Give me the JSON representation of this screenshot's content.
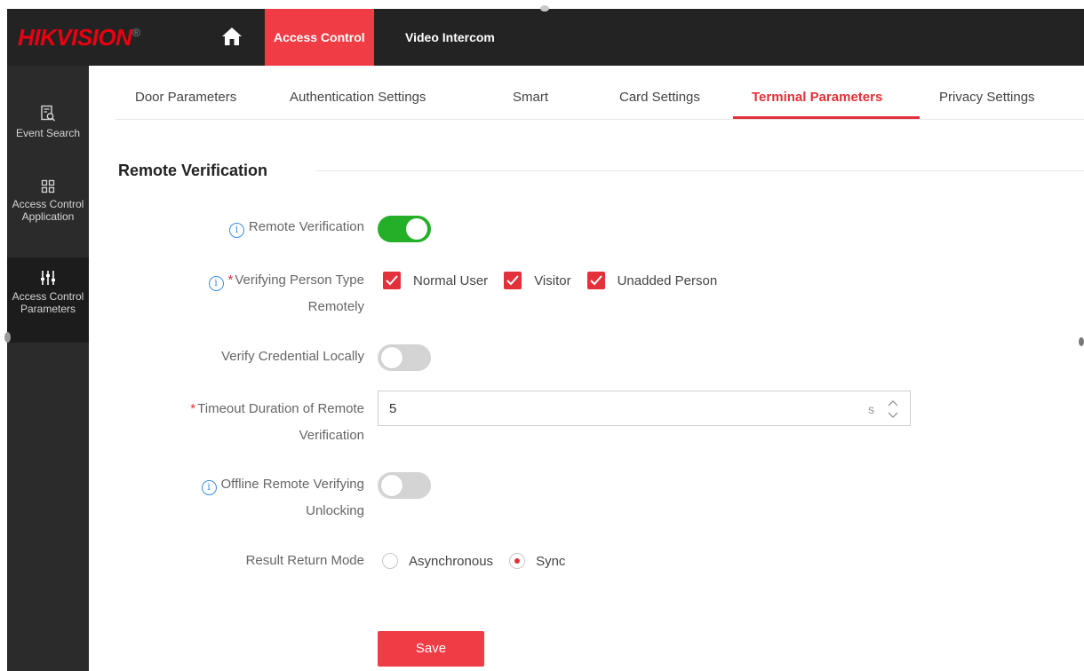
{
  "header": {
    "logo_main": "HIKVISION",
    "logo_mark": "®",
    "nav": [
      "Access Control",
      "Video Intercom"
    ],
    "home_icon": "home-icon"
  },
  "sidebar": {
    "items": [
      {
        "label": "Event Search",
        "icon": "event-search-icon"
      },
      {
        "label": "Access Control Application",
        "icon": "grid-icon"
      },
      {
        "label": "Access Control Parameters",
        "icon": "sliders-icon"
      }
    ]
  },
  "tabs": [
    "Door Parameters",
    "Authentication Settings",
    "Smart",
    "Card Settings",
    "Terminal Parameters",
    "Privacy Settings"
  ],
  "active_tab": "Terminal Parameters",
  "section": {
    "title": "Remote Verification"
  },
  "form": {
    "remote_verification": {
      "label": "Remote Verification",
      "on": true
    },
    "verifying_person_type": {
      "label_line1": "Verifying Person Type",
      "label_line2": "Remotely",
      "options": [
        "Normal User",
        "Visitor",
        "Unadded Person"
      ]
    },
    "verify_credential_locally": {
      "label": "Verify Credential Locally",
      "on": false
    },
    "timeout": {
      "label_line1": "Timeout Duration of Remote",
      "label_line2": "Verification",
      "value": "5",
      "unit": "s"
    },
    "offline_unlocking": {
      "label_line1": "Offline Remote Verifying",
      "label_line2": "Unlocking",
      "on": false
    },
    "result_return_mode": {
      "label": "Result Return Mode",
      "options": [
        "Asynchronous",
        "Sync"
      ],
      "selected": "Sync"
    }
  },
  "actions": {
    "save": "Save"
  },
  "colors": {
    "accent": "#f03c45",
    "toggle_on": "#23b028",
    "info": "#3b8ee6"
  }
}
